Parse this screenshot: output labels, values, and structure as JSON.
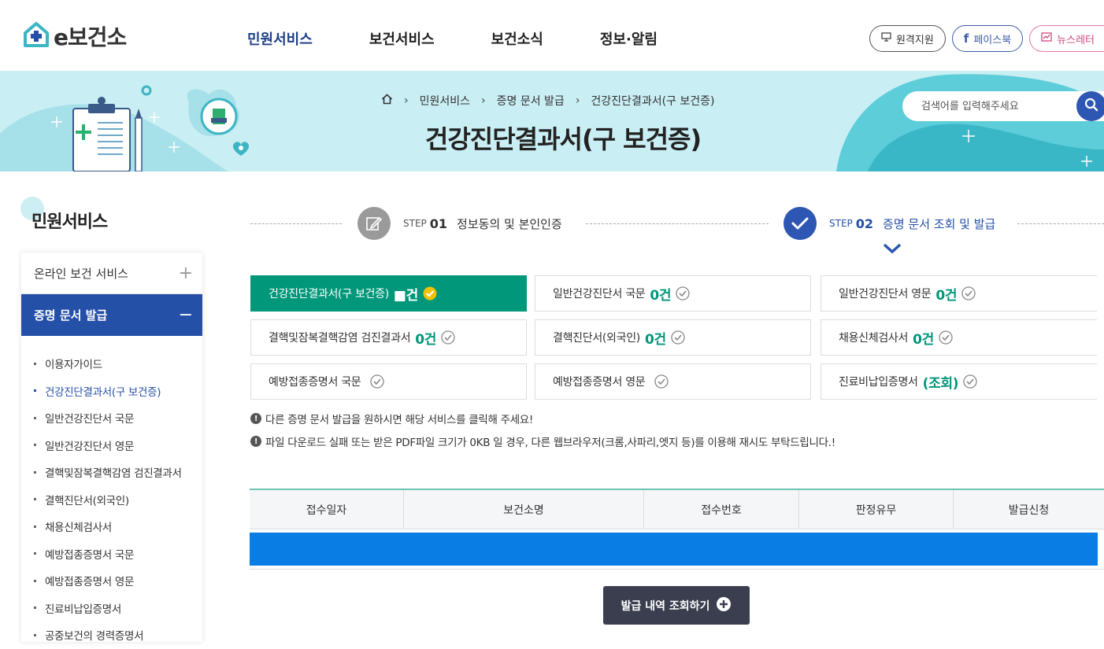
{
  "util": {
    "pill": "",
    "text": "",
    "zoom": ""
  },
  "logo": {
    "text": "e보건소"
  },
  "nav": [
    "민원서비스",
    "보건서비스",
    "보건소식",
    "정보·알림"
  ],
  "header_buttons": {
    "remote": "원격지원",
    "facebook": "페이스북",
    "newsletter": "뉴스레터"
  },
  "breadcrumb": [
    "민원서비스",
    "증명 문서 발급",
    "건강진단결과서(구 보건증)"
  ],
  "page_title": "건강진단결과서(구 보건증)",
  "search": {
    "placeholder": "검색어를 입력해주세요"
  },
  "sidebar": {
    "title": "민원서비스",
    "categories": [
      {
        "label": "온라인 보건 서비스",
        "sign": "+"
      },
      {
        "label": "증명 문서 발급",
        "sign": "−"
      }
    ],
    "items": [
      "이용자가이드",
      "건강진단결과서(구 보건증)",
      "일반건강진단서 국문",
      "일반건강진단서 영문",
      "결핵및잠복결핵감염 검진결과서",
      "결핵진단서(외국인)",
      "채용신체검사서",
      "예방접종증명서 국문",
      "예방접종증명서 영문",
      "진료비납입증명서",
      "공중보건의 경력증명서"
    ]
  },
  "steps": [
    {
      "label": "STEP",
      "num": "01",
      "text": "정보동의 및 본인인증"
    },
    {
      "label": "STEP",
      "num": "02",
      "text": "증명 문서 조회 및 발급"
    }
  ],
  "documents": [
    {
      "name": "건강진단결과서(구 보건증)",
      "count": "■건"
    },
    {
      "name": "일반건강진단서 국문",
      "count": "0건"
    },
    {
      "name": "일반건강진단서 영문",
      "count": "0건"
    },
    {
      "name": "결핵및잠복결핵감염 검진결과서",
      "count": "0건"
    },
    {
      "name": "결핵진단서(외국인)",
      "count": "0건"
    },
    {
      "name": "채용신체검사서",
      "count": "0건"
    },
    {
      "name": "예방접종증명서 국문",
      "count": ""
    },
    {
      "name": "예방접종증명서 영문",
      "count": ""
    },
    {
      "name": "진료비납입증명서",
      "count": "(조회)"
    }
  ],
  "notices": [
    "다른 증명 문서 발급을 원하시면 해당 서비스를 클릭해 주세요!",
    "파일 다운로드 실패 또는 받은 PDF파일 크기가 0KB 일 경우, 다른 웹브라우저(크롬,사파리,엣지 등)를 이용해 재시도 부탁드립니다.!"
  ],
  "table": {
    "headers": [
      "접수일자",
      "보건소명",
      "접수번호",
      "판정유무",
      "발급신청"
    ]
  },
  "more_button": "발급 내역 조회하기",
  "colors": {
    "primary": "#2550a8",
    "green": "#00977a",
    "banner": "#c9eef3",
    "row_highlight": "#0a7de4"
  }
}
